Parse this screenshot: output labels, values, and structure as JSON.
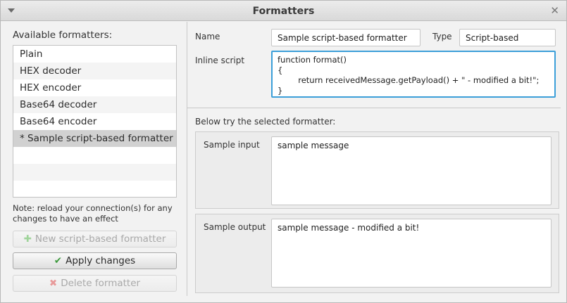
{
  "window": {
    "title": "Formatters"
  },
  "left_panel": {
    "heading": "Available formatters:",
    "formatters": [
      "Plain",
      "HEX decoder",
      "HEX encoder",
      "Base64 decoder",
      "Base64 encoder",
      "* Sample script-based formatter"
    ],
    "selected_index": 5,
    "note": "Note: reload your connection(s) for any changes to have an effect",
    "new_button_label": "New script-based formatter",
    "apply_button_label": "Apply changes",
    "delete_button_label": "Delete formatter"
  },
  "details": {
    "name_label": "Name",
    "name_value": "Sample script-based formatter",
    "type_label": "Type",
    "type_value": "Script-based",
    "script_label": "Inline script",
    "script_lines": [
      "function format()",
      "{",
      "        return receivedMessage.getPayload() + \" - modified a bit!\";",
      "}"
    ]
  },
  "tryout": {
    "heading": "Below try the selected formatter:",
    "input_label": "Sample input",
    "input_value": "sample message",
    "output_label": "Sample output",
    "output_value": "sample message - modified a bit!"
  },
  "icons": {
    "menu": "chevron-down-icon",
    "close": "close-icon",
    "new": "plus-icon",
    "apply": "check-icon",
    "delete": "x-icon"
  },
  "colors": {
    "focus_border": "#3c9fd9",
    "apply_icon": "#3e9a3e",
    "selected_row": "#d1d1d1"
  }
}
